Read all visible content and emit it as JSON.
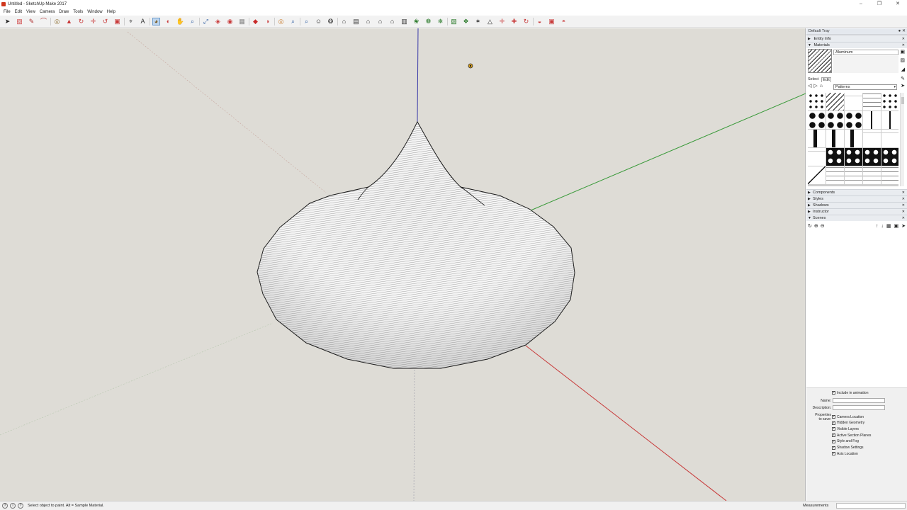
{
  "window": {
    "title": "Untitled - SketchUp Make 2017",
    "controls": [
      "–",
      "❐",
      "✕"
    ]
  },
  "menu": [
    "File",
    "Edit",
    "View",
    "Camera",
    "Draw",
    "Tools",
    "Window",
    "Help"
  ],
  "toolbar": {
    "tools": [
      {
        "name": "select-tool-icon",
        "glyph": "➤",
        "color": "#222222"
      },
      {
        "name": "eraser-tool-icon",
        "glyph": "▨",
        "color": "#d04a4a"
      },
      {
        "name": "pencil-tool-icon",
        "glyph": "✎",
        "color": "#b03030"
      },
      {
        "name": "arc-tool-icon",
        "glyph": "⌒",
        "color": "#b03030"
      },
      {
        "name": "shape-tool-icon",
        "glyph": "◎",
        "color": "#8a6a2a"
      },
      {
        "name": "push-pull-icon",
        "glyph": "▲",
        "color": "#c83a3a"
      },
      {
        "name": "follow-me-icon",
        "glyph": "↻",
        "color": "#c83a3a"
      },
      {
        "name": "move-tool-icon",
        "glyph": "✛",
        "color": "#c83a3a"
      },
      {
        "name": "rotate-tool-icon",
        "glyph": "↺",
        "color": "#c83a3a"
      },
      {
        "name": "scale-tool-icon",
        "glyph": "▣",
        "color": "#c83a3a"
      },
      {
        "name": "tape-measure-icon",
        "glyph": "⌖",
        "color": "#555555"
      },
      {
        "name": "text-tool-icon",
        "glyph": "A",
        "color": "#333333"
      },
      {
        "name": "paint-bucket-icon",
        "glyph": "◕",
        "color": "#7a5a20"
      },
      {
        "name": "orbit-tool-icon",
        "glyph": "◐",
        "color": "#c83a3a"
      },
      {
        "name": "pan-tool-icon",
        "glyph": "✋",
        "color": "#c83a3a"
      },
      {
        "name": "zoom-tool-icon",
        "glyph": "⌕",
        "color": "#2a5aa0"
      },
      {
        "name": "zoom-extents-icon",
        "glyph": "⤢",
        "color": "#2a5aa0"
      },
      {
        "name": "warehouse-icon",
        "glyph": "◈",
        "color": "#c83a3a"
      },
      {
        "name": "extension-icon",
        "glyph": "◉",
        "color": "#c83a3a"
      },
      {
        "name": "components-icon",
        "glyph": "▦",
        "color": "#888888"
      },
      {
        "name": "ruby-icon",
        "glyph": "◆",
        "color": "#c82a2a"
      },
      {
        "name": "section-plane-icon",
        "glyph": "◑",
        "color": "#c83a3a"
      },
      {
        "name": "look-around-icon",
        "glyph": "◎",
        "color": "#c87a2a"
      },
      {
        "name": "zoom-window-icon",
        "glyph": "⌕",
        "color": "#2a5aa0"
      },
      {
        "name": "previous-view-icon",
        "glyph": "⌕",
        "color": "#2a5aa0"
      },
      {
        "name": "position-camera-icon",
        "glyph": "☺",
        "color": "#333333"
      },
      {
        "name": "walk-tool-icon",
        "glyph": "❂",
        "color": "#333333"
      },
      {
        "name": "iso-view-icon",
        "glyph": "⌂",
        "color": "#333333"
      },
      {
        "name": "top-view-icon",
        "glyph": "▤",
        "color": "#333333"
      },
      {
        "name": "front-view-icon",
        "glyph": "⌂",
        "color": "#333333"
      },
      {
        "name": "right-view-icon",
        "glyph": "⌂",
        "color": "#333333"
      },
      {
        "name": "back-view-icon",
        "glyph": "⌂",
        "color": "#333333"
      },
      {
        "name": "left-view-icon",
        "glyph": "▥",
        "color": "#333333"
      },
      {
        "name": "sandbox-contours-icon",
        "glyph": "❀",
        "color": "#2a7a2a"
      },
      {
        "name": "sandbox-scratch-icon",
        "glyph": "❁",
        "color": "#2a7a2a"
      },
      {
        "name": "sandbox-smoove-icon",
        "glyph": "❄",
        "color": "#2a7a2a"
      },
      {
        "name": "sandbox-stamp-icon",
        "glyph": "▧",
        "color": "#2a7a2a"
      },
      {
        "name": "sandbox-drape-icon",
        "glyph": "❖",
        "color": "#2a7a2a"
      },
      {
        "name": "add-detail-icon",
        "glyph": "✶",
        "color": "#333333"
      },
      {
        "name": "flip-edge-icon",
        "glyph": "△",
        "color": "#333333"
      },
      {
        "name": "move-copy-icon",
        "glyph": "✛",
        "color": "#c83a3a"
      },
      {
        "name": "move-copy-2-icon",
        "glyph": "✚",
        "color": "#c83a3a"
      },
      {
        "name": "rotate-copy-icon",
        "glyph": "↻",
        "color": "#c83a3a"
      },
      {
        "name": "camera-extension-icon",
        "glyph": "◒",
        "color": "#c83a3a"
      },
      {
        "name": "scale-extension-icon",
        "glyph": "▣",
        "color": "#c83a3a"
      },
      {
        "name": "send-layout-icon",
        "glyph": "◓",
        "color": "#c83a3a"
      }
    ],
    "active_tool": "paint-bucket-icon"
  },
  "tray": {
    "title": "Default Tray",
    "entity_info": "Entity Info",
    "materials": "Materials",
    "material_name": "Aluminum",
    "tab_select": "Select",
    "tab_edit": "Edit",
    "library": "Patterns",
    "sections": [
      "Components",
      "Styles",
      "Shadows",
      "Instructor",
      "Scenes"
    ]
  },
  "scene_props": {
    "include_animation": "Include in animation",
    "name_label": "Name:",
    "name_value": "",
    "description_label": "Description:",
    "description_value": "",
    "properties_label_1": "Properties",
    "properties_label_2": "to save:",
    "checks": [
      "Camera Location",
      "Hidden Geometry",
      "Visible Layers",
      "Active Section Planes",
      "Style and Fog",
      "Shadow Settings",
      "Axis Location"
    ]
  },
  "status": {
    "hint": "Select object to paint. Alt = Sample Material.",
    "measurements_label": "Measurements",
    "measurements_value": ""
  },
  "colors": {
    "viewport_bg": "#dedcd6",
    "axis_blue": "#3a3aa8",
    "axis_green": "#3a9a3a",
    "axis_red": "#c83a3a",
    "axis_dotted": "#c8a8a0",
    "edge": "#111111"
  }
}
